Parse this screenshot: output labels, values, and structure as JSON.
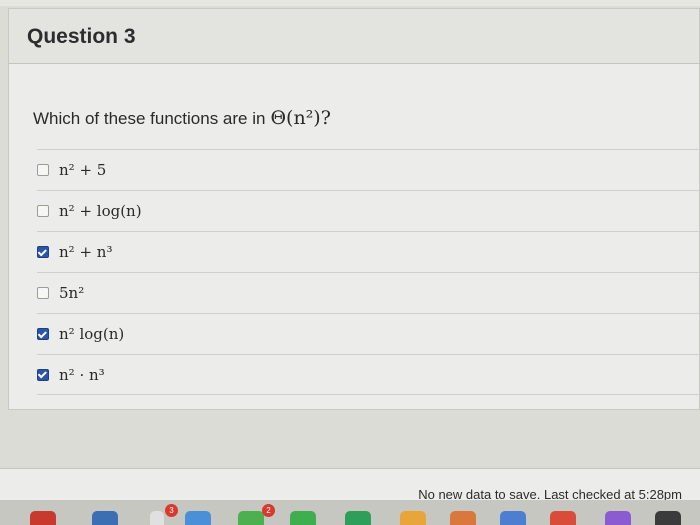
{
  "question": {
    "title": "Question 3",
    "prompt_text": "Which of these functions are in",
    "prompt_math": "Θ(n²)",
    "answers": [
      {
        "label": "n² + 5",
        "checked": false
      },
      {
        "label": "n² + log(n)",
        "checked": false
      },
      {
        "label": "n² + n³",
        "checked": true
      },
      {
        "label": "5n²",
        "checked": false
      },
      {
        "label": "n² log(n)",
        "checked": true
      },
      {
        "label": "n² · n³",
        "checked": true
      }
    ]
  },
  "footer": {
    "save_status": "No new data to save. Last checked at 5:28pm"
  },
  "dock": {
    "badges": [
      "3",
      "2"
    ]
  }
}
